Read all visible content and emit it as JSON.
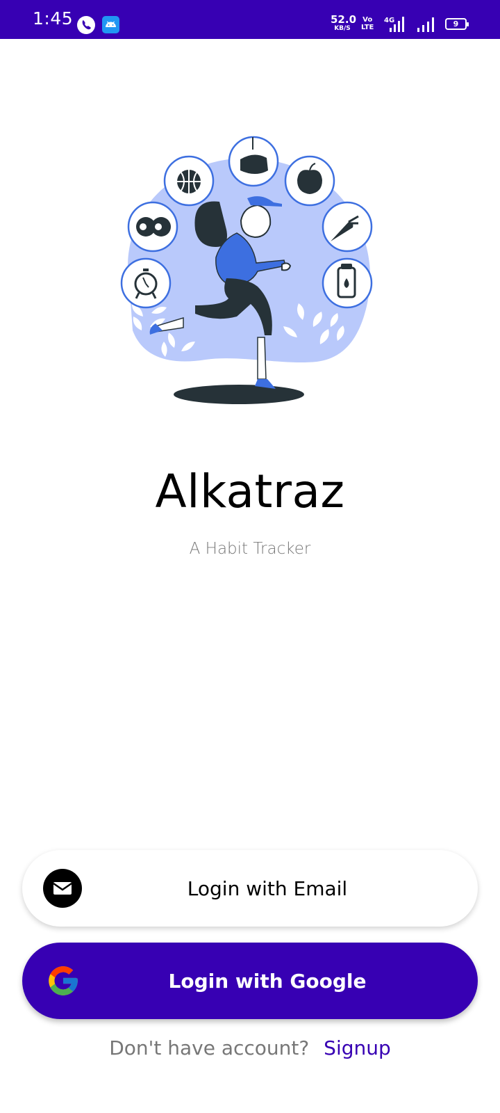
{
  "status_bar": {
    "time": "1:45",
    "net_speed_value": "52.0",
    "net_speed_unit": "KB/S",
    "volte_top": "Vo",
    "volte_bottom": "LTE",
    "network_label": "4G",
    "battery_level": "9",
    "background_color": "#3700b3"
  },
  "app": {
    "title": "Alkatraz",
    "subtitle": "A Habit Tracker"
  },
  "hero": {
    "illustration": "running-woman-with-habit-icons",
    "habit_icons": [
      "alarm-clock-icon",
      "dumbbell-icon",
      "basketball-icon",
      "meditation-icon",
      "apple-icon",
      "carrot-icon",
      "water-bottle-icon"
    ]
  },
  "buttons": {
    "email_label": "Login with Email",
    "email_icon": "mail-icon",
    "google_label": "Login with Google",
    "google_icon": "google-icon",
    "google_color": "#3700b3"
  },
  "footer": {
    "prompt": "Don't have account?",
    "signup_label": "Signup"
  }
}
